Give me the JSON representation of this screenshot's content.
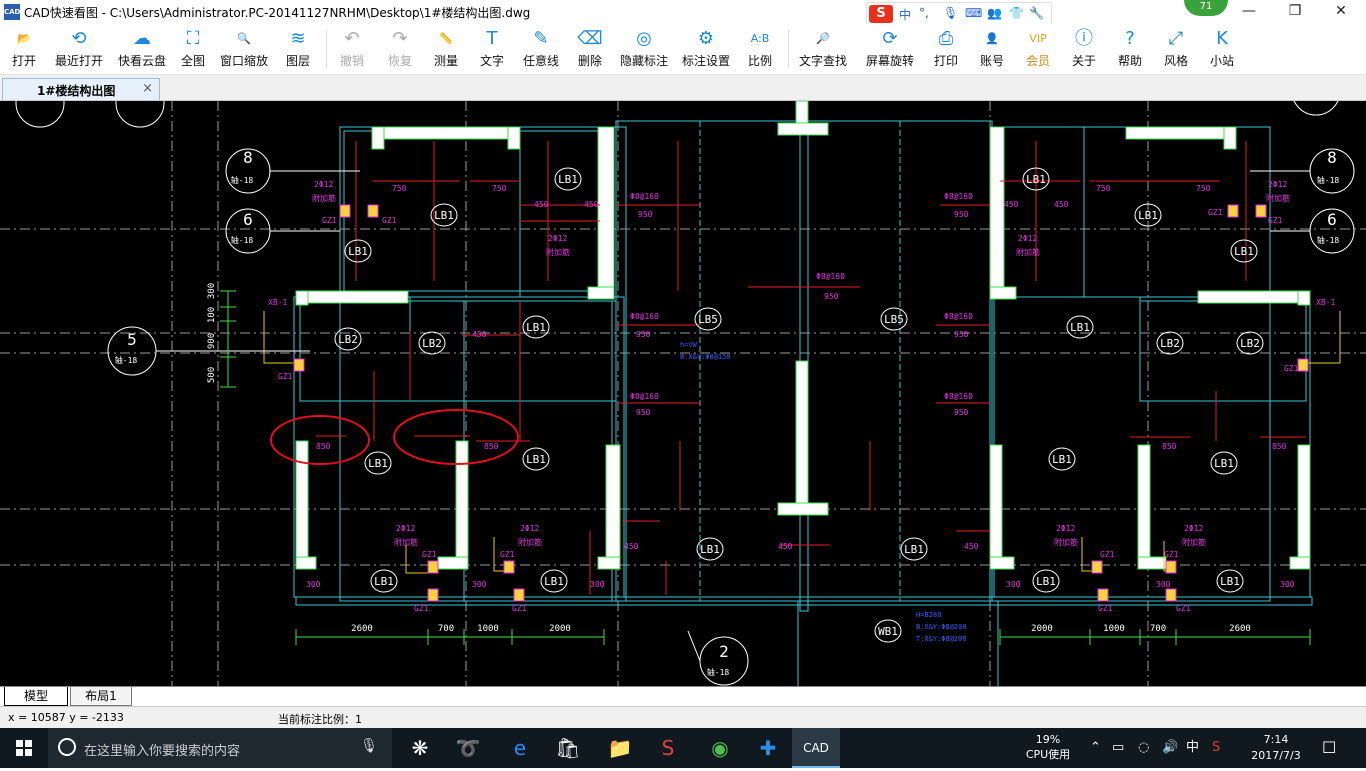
{
  "window": {
    "title": "CAD快速看图 - C:\\Users\\Administrator.PC-20141127NRHM\\Desktop\\1#楼结构出图.dwg",
    "icon_label": "CAD",
    "badge": "71",
    "controls": [
      "minimize-icon",
      "restore-icon",
      "close-icon"
    ]
  },
  "ime": {
    "logo": "S",
    "mode": "中",
    "punct": "°,",
    "icons": [
      "mic-icon",
      "keyboard-icon",
      "user-icon",
      "shirt-icon",
      "wrench-icon"
    ]
  },
  "toolbar": [
    {
      "label": "打开",
      "icon": "folder-icon",
      "glyph": "📂"
    },
    {
      "label": "最近打开",
      "icon": "history-icon",
      "glyph": "⟲"
    },
    {
      "label": "快看云盘",
      "icon": "cloud-icon",
      "glyph": "☁"
    },
    {
      "label": "全图",
      "icon": "fit-all-icon",
      "glyph": "⛶"
    },
    {
      "label": "窗口缩放",
      "icon": "zoom-window-icon",
      "glyph": "🔍"
    },
    {
      "label": "图层",
      "icon": "layers-icon",
      "glyph": "≋"
    },
    {
      "label": "撤销",
      "icon": "undo-icon",
      "glyph": "↶",
      "disabled": true
    },
    {
      "label": "恢复",
      "icon": "redo-icon",
      "glyph": "↷",
      "disabled": true
    },
    {
      "label": "测量",
      "icon": "ruler-icon",
      "glyph": "📏"
    },
    {
      "label": "文字",
      "icon": "text-icon",
      "glyph": "T"
    },
    {
      "label": "任意线",
      "icon": "pen-icon",
      "glyph": "✎"
    },
    {
      "label": "删除",
      "icon": "eraser-icon",
      "glyph": "⌫"
    },
    {
      "label": "隐藏标注",
      "icon": "hide-eye-icon",
      "glyph": "◎"
    },
    {
      "label": "标注设置",
      "icon": "settings-icon",
      "glyph": "⚙"
    },
    {
      "label": "比例",
      "icon": "scale-icon",
      "glyph": "A:B"
    },
    {
      "label": "文字查找",
      "icon": "text-search-icon",
      "glyph": "🔎"
    },
    {
      "label": "屏幕旋转",
      "icon": "rotate-icon",
      "glyph": "⟳"
    },
    {
      "label": "打印",
      "icon": "printer-icon",
      "glyph": "⎙"
    },
    {
      "label": "账号",
      "icon": "account-icon",
      "glyph": "👤"
    },
    {
      "label": "会员",
      "icon": "vip-icon",
      "glyph": "VIP",
      "vip": true
    },
    {
      "label": "关于",
      "icon": "info-icon",
      "glyph": "ⓘ"
    },
    {
      "label": "帮助",
      "icon": "help-icon",
      "glyph": "?"
    },
    {
      "label": "风格",
      "icon": "style-icon",
      "glyph": "⤢"
    },
    {
      "label": "小站",
      "icon": "site-icon",
      "glyph": "K"
    }
  ],
  "tab": {
    "title": "1#楼结构出图",
    "close": "×"
  },
  "drawing": {
    "slab_labels": [
      "LB1",
      "LB2",
      "LB5",
      "WB1"
    ],
    "axis_bubbles": [
      {
        "num": "8",
        "tag": "轴-18"
      },
      {
        "num": "6",
        "tag": "轴-18"
      },
      {
        "num": "5",
        "tag": "轴-18"
      },
      {
        "num": "2",
        "tag": "轴-18"
      }
    ],
    "dimensions": [
      "2600",
      "700",
      "1000",
      "2000"
    ],
    "dims_left": [
      "300",
      "100",
      "900",
      "500"
    ],
    "rebar": [
      "Φ8@160",
      "Φ8@160"
    ],
    "values": [
      "850",
      "750",
      "450",
      "950",
      "300",
      "150"
    ],
    "wall_tags": [
      "GZ1",
      "XB-1"
    ],
    "bar_note": "2Φ12",
    "bar_note2": "附加筋"
  },
  "layout_tabs": [
    "模型",
    "布局1"
  ],
  "status": {
    "coords": "x = 10587  y = -2133",
    "scale": "当前标注比例：1"
  },
  "taskbar": {
    "search_placeholder": "在这里输入你要搜索的内容",
    "cpu_pct": "19%",
    "cpu_label": "CPU使用",
    "ime": "中",
    "time": "7:14",
    "date": "2017/7/3"
  }
}
